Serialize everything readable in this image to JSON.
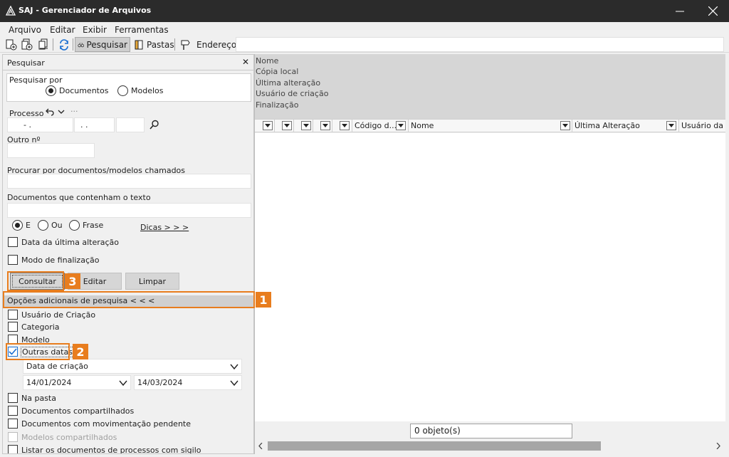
{
  "window": {
    "title": "SAJ - Gerenciador de Arquivos"
  },
  "menu": [
    {
      "label": "Arquivo"
    },
    {
      "label": "Editar"
    },
    {
      "label": "Exibir"
    },
    {
      "label": "Ferramentas"
    }
  ],
  "toolbar": {
    "search_label": "Pesquisar",
    "folders_label": "Pastas",
    "address_label": "Endereço",
    "address_value": ""
  },
  "panel": {
    "title": "Pesquisar",
    "search_by": "Pesquisar por",
    "opt_documents": "Documentos",
    "opt_models": "Modelos",
    "process_label": "Processo",
    "process_part1": "-  .",
    "process_part2": ".  .",
    "other_no_label": "Outro nº",
    "named_label": "Procurar por documentos/modelos chamados",
    "contains_label": "Documentos que contenham o texto",
    "radio_e": "E",
    "radio_ou": "Ou",
    "radio_frase": "Frase",
    "tips_link": "Dicas > > >",
    "last_change_label": "Data da última alteração",
    "finalization_mode_label": "Modo de finalização",
    "btn_consult": "Consultar",
    "btn_edit": "Editar",
    "btn_clear": "Limpar",
    "extra_options": "Opções adicionais de pesquisa < < <",
    "opt_creation_user": "Usuário de Criação",
    "opt_category": "Categoria",
    "opt_model": "Modelo",
    "opt_other_dates": "Outras datas",
    "date_type": "Data de criação",
    "date_from": "14/01/2024",
    "date_to": "14/03/2024",
    "opt_in_folder": "Na pasta",
    "opt_shared_docs": "Documentos compartilhados",
    "opt_pending_docs": "Documentos com movimentação pendente",
    "opt_shared_models": "Modelos compartilhados",
    "opt_list_secret": "Listar os documentos de processos com sigilo"
  },
  "info": {
    "rows": [
      "Nome",
      "Cópia local",
      "Última alteração",
      "Usuário de criação",
      "Finalização"
    ]
  },
  "grid": {
    "columns": [
      "Código d...",
      "Nome",
      "Última Alteração",
      "Usuário da"
    ]
  },
  "status": {
    "count": "0 objeto(s)"
  },
  "callouts": [
    "1",
    "2",
    "3"
  ],
  "colors": {
    "accent": "#e87d1e",
    "titlebar": "#2b2b2b",
    "check": "#1a6fd1"
  }
}
